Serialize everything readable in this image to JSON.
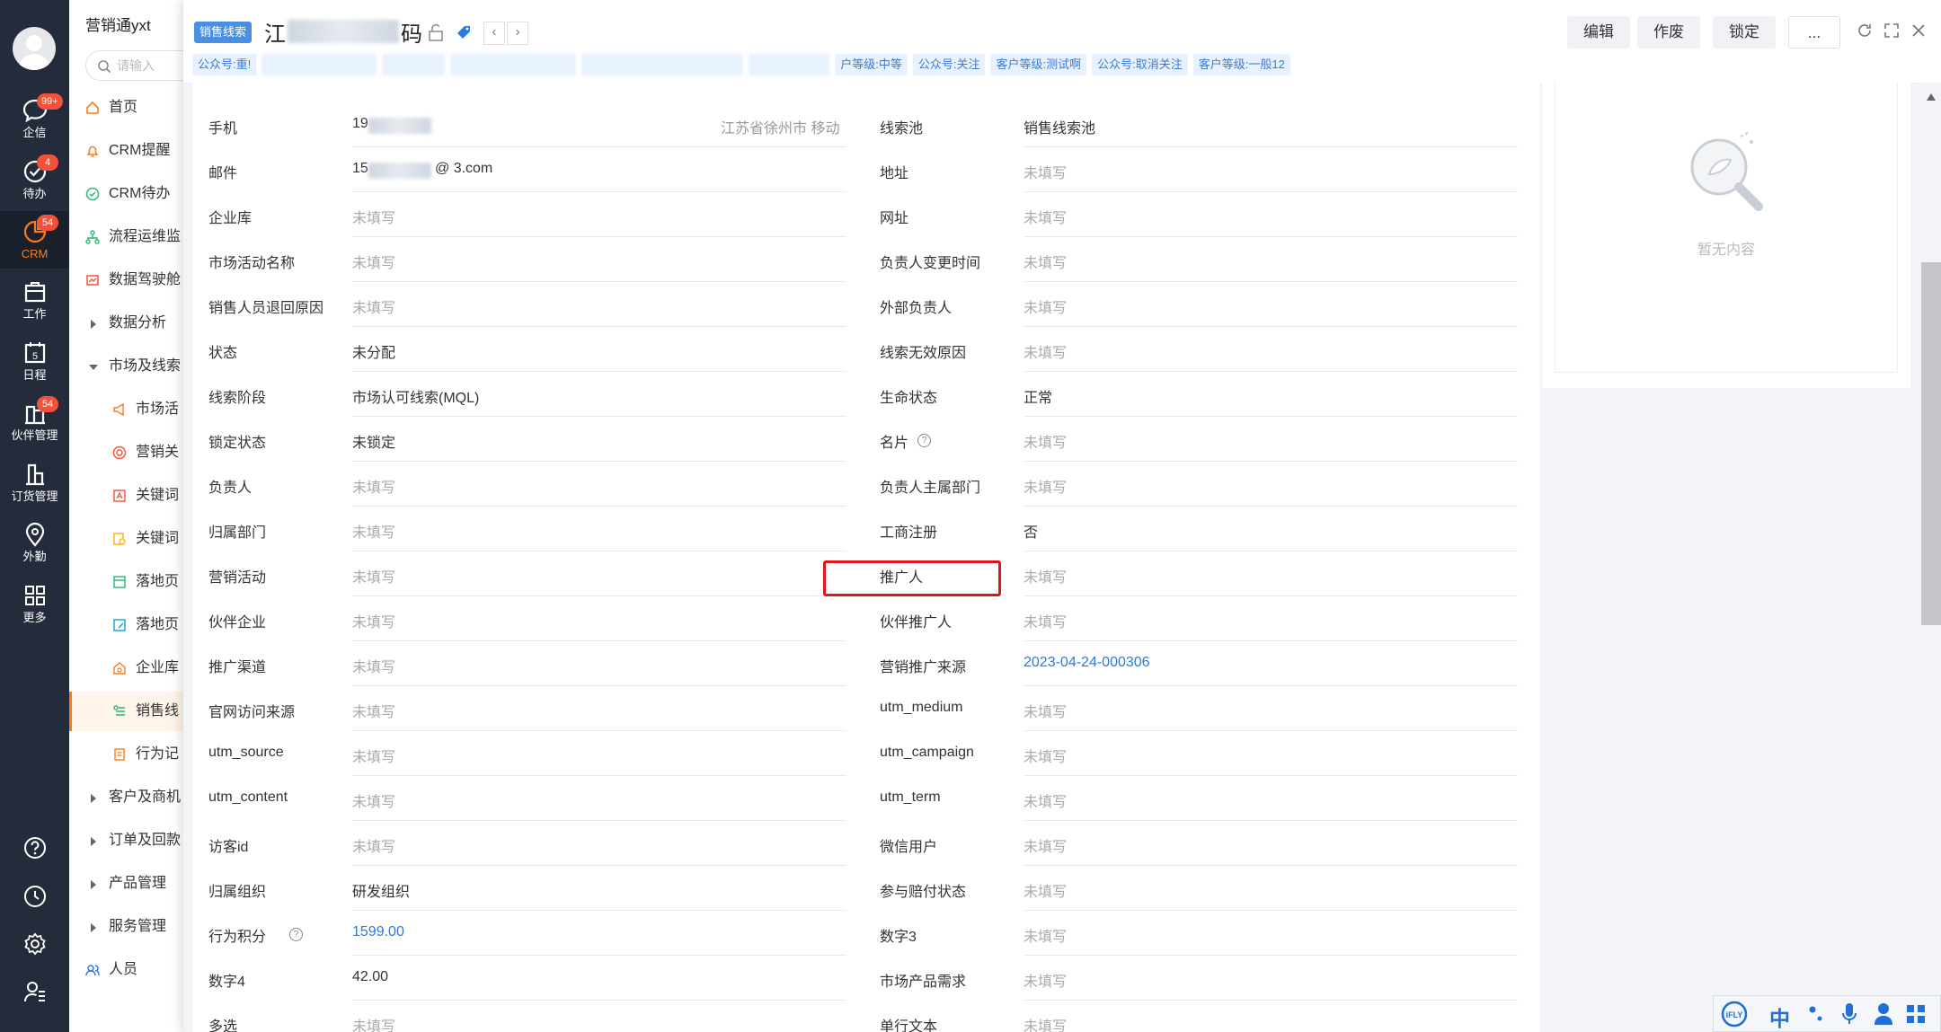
{
  "rail": {
    "items": [
      {
        "label": "企信",
        "badge": "99+"
      },
      {
        "label": "待办",
        "badge": "4"
      },
      {
        "label": "CRM",
        "badge": "54"
      },
      {
        "label": "工作",
        "badge": ""
      },
      {
        "label": "日程",
        "badge": ""
      },
      {
        "label": "伙伴管理",
        "badge": "54"
      },
      {
        "label": "订货管理",
        "badge": ""
      },
      {
        "label": "外勤",
        "badge": ""
      },
      {
        "label": "更多",
        "badge": ""
      }
    ],
    "calendar_day": "5"
  },
  "nav": {
    "title": "营销通yxt",
    "search_placeholder": "请输入",
    "items": [
      {
        "label": "首页"
      },
      {
        "label": "CRM提醒"
      },
      {
        "label": "CRM待办"
      },
      {
        "label": "流程运维监"
      },
      {
        "label": "数据驾驶舱"
      },
      {
        "label": "数据分析"
      },
      {
        "label": "市场及线索"
      },
      {
        "label": "市场活"
      },
      {
        "label": "营销关"
      },
      {
        "label": "关键词"
      },
      {
        "label": "关键词"
      },
      {
        "label": "落地页"
      },
      {
        "label": "落地页"
      },
      {
        "label": "企业库"
      },
      {
        "label": "销售线"
      },
      {
        "label": "行为记"
      },
      {
        "label": "客户及商机"
      },
      {
        "label": "订单及回款"
      },
      {
        "label": "产品管理"
      },
      {
        "label": "服务管理"
      },
      {
        "label": "人员"
      }
    ]
  },
  "header": {
    "type_tag": "销售线索",
    "title_start": "江",
    "title_end": "码",
    "buttons": {
      "edit": "编辑",
      "void": "作废",
      "lock": "锁定",
      "more": "..."
    },
    "nav_prev": "‹",
    "nav_next": "›",
    "chips": [
      "公众号:重!",
      "户等级:中等",
      "公众号:关注",
      "客户等级:测试啊",
      "公众号:取消关注",
      "客户等级:一般12"
    ]
  },
  "fields_left": [
    {
      "label": "手机",
      "value": "19",
      "empty": false,
      "extra": "江苏省徐州市 移动"
    },
    {
      "label": "邮件",
      "value": "15",
      "value_tail": "@   3.com",
      "empty": false
    },
    {
      "label": "企业库",
      "value": "未填写",
      "empty": true
    },
    {
      "label": "市场活动名称",
      "value": "未填写",
      "empty": true
    },
    {
      "label": "销售人员退回原因",
      "value": "未填写",
      "empty": true
    },
    {
      "label": "状态",
      "value": "未分配",
      "empty": false
    },
    {
      "label": "线索阶段",
      "value": "市场认可线索(MQL)",
      "empty": false
    },
    {
      "label": "锁定状态",
      "value": "未锁定",
      "empty": false
    },
    {
      "label": "负责人",
      "value": "未填写",
      "empty": true
    },
    {
      "label": "归属部门",
      "value": "未填写",
      "empty": true
    },
    {
      "label": "营销活动",
      "value": "未填写",
      "empty": true
    },
    {
      "label": "伙伴企业",
      "value": "未填写",
      "empty": true
    },
    {
      "label": "推广渠道",
      "value": "未填写",
      "empty": true
    },
    {
      "label": "官网访问来源",
      "value": "未填写",
      "empty": true
    },
    {
      "label": "utm_source",
      "value": "未填写",
      "empty": true
    },
    {
      "label": "utm_content",
      "value": "未填写",
      "empty": true
    },
    {
      "label": "访客id",
      "value": "未填写",
      "empty": true
    },
    {
      "label": "归属组织",
      "value": "研发组织",
      "empty": false
    },
    {
      "label": "行为积分",
      "value": "1599.00",
      "empty": false,
      "link": true,
      "help": true
    },
    {
      "label": "数字4",
      "value": "42.00",
      "empty": false
    },
    {
      "label": "多选",
      "value": "未填写",
      "empty": true
    }
  ],
  "fields_right": [
    {
      "label": "线索池",
      "value": "销售线索池",
      "empty": false
    },
    {
      "label": "地址",
      "value": "未填写",
      "empty": true
    },
    {
      "label": "网址",
      "value": "未填写",
      "empty": true
    },
    {
      "label": "负责人变更时间",
      "value": "未填写",
      "empty": true
    },
    {
      "label": "外部负责人",
      "value": "未填写",
      "empty": true
    },
    {
      "label": "线索无效原因",
      "value": "未填写",
      "empty": true
    },
    {
      "label": "生命状态",
      "value": "正常",
      "empty": false
    },
    {
      "label": "名片",
      "value": "未填写",
      "empty": true,
      "help": true
    },
    {
      "label": "负责人主属部门",
      "value": "未填写",
      "empty": true
    },
    {
      "label": "工商注册",
      "value": "否",
      "empty": false
    },
    {
      "label": "推广人",
      "value": "未填写",
      "empty": true
    },
    {
      "label": "伙伴推广人",
      "value": "未填写",
      "empty": true
    },
    {
      "label": "营销推广来源",
      "value": "2023-04-24-000306",
      "empty": false,
      "link": true
    },
    {
      "label": "utm_medium",
      "value": "未填写",
      "empty": true
    },
    {
      "label": "utm_campaign",
      "value": "未填写",
      "empty": true
    },
    {
      "label": "utm_term",
      "value": "未填写",
      "empty": true
    },
    {
      "label": "微信用户",
      "value": "未填写",
      "empty": true
    },
    {
      "label": "参与赔付状态",
      "value": "未填写",
      "empty": true
    },
    {
      "label": "数字3",
      "value": "未填写",
      "empty": true
    },
    {
      "label": "市场产品需求",
      "value": "未填写",
      "empty": true
    },
    {
      "label": "单行文本",
      "value": "未填写",
      "empty": true
    }
  ],
  "side_panel": {
    "empty_text": "暂无内容"
  },
  "ime": {
    "lang": "中"
  },
  "colors": {
    "accent": "#ff7a1a",
    "link": "#2a7ae2",
    "highlight": "#e0151b",
    "rail_bg": "#242b3a"
  }
}
